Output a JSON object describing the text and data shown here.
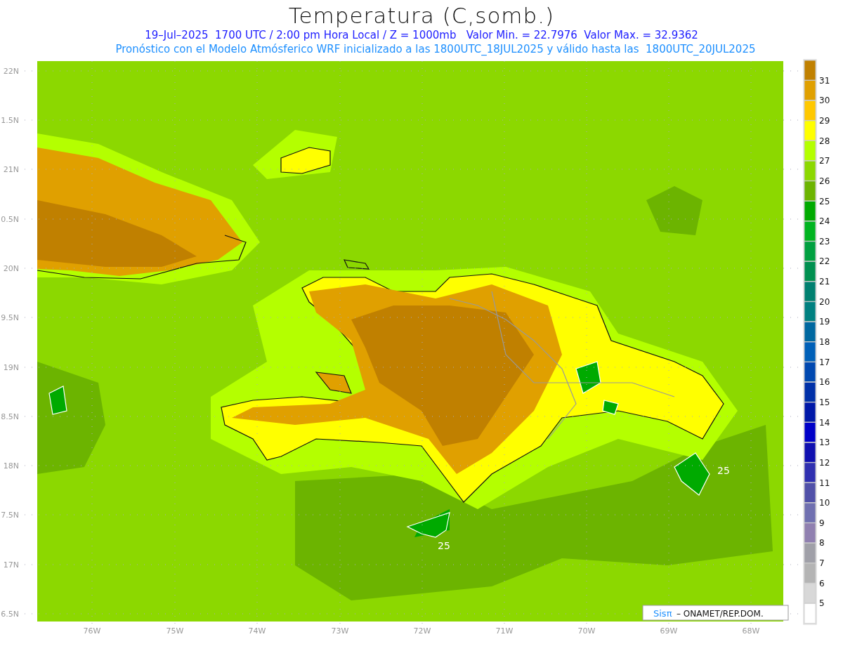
{
  "title": "Temperatura (C,somb.)",
  "subtitle": "19–Jul–2025  1700 UTC / 2:00 pm Hora Local / Z = 1000mb   Valor Min. = 22.7976  Valor Max. = 32.9362",
  "forecast_note": "Pronóstico con el Modelo Atmósferico WRF inicializado a las 1800UTC_18JUL2025 y válido hasta las  1800UTC_20JUL2025",
  "latitude_labels": [
    "22N",
    "1.5N",
    "21N",
    "0.5N",
    "20N",
    "9.5N",
    "19N",
    "8.5N",
    "18N",
    "7.5N",
    "17N",
    "6.5N"
  ],
  "longitude_labels": [
    "76W",
    "75W",
    "74W",
    "73W",
    "72W",
    "71W",
    "70W",
    "69W",
    "68W"
  ],
  "contour_labels": [
    "25",
    "25"
  ],
  "colorbar": [
    {
      "color": "#c08000",
      "label": "31"
    },
    {
      "color": "#e0a000",
      "label": "30"
    },
    {
      "color": "#ffc800",
      "label": "29"
    },
    {
      "color": "#ffff00",
      "label": "28"
    },
    {
      "color": "#b4ff00",
      "label": "27"
    },
    {
      "color": "#8cd800",
      "label": "26"
    },
    {
      "color": "#6cb400",
      "label": "25"
    },
    {
      "color": "#00aa00",
      "label": "24"
    },
    {
      "color": "#00b420",
      "label": "23"
    },
    {
      "color": "#00a040",
      "label": "22"
    },
    {
      "color": "#009050",
      "label": "21"
    },
    {
      "color": "#008070",
      "label": "20"
    },
    {
      "color": "#008080",
      "label": "19"
    },
    {
      "color": "#0068a0",
      "label": "18"
    },
    {
      "color": "#0060b8",
      "label": "17"
    },
    {
      "color": "#0048b0",
      "label": "16"
    },
    {
      "color": "#0030a8",
      "label": "15"
    },
    {
      "color": "#0018a8",
      "label": "14"
    },
    {
      "color": "#0000c8",
      "label": "13"
    },
    {
      "color": "#1010b0",
      "label": "12"
    },
    {
      "color": "#3030b0",
      "label": "11"
    },
    {
      "color": "#5050a8",
      "label": "10"
    },
    {
      "color": "#7070b0",
      "label": "9"
    },
    {
      "color": "#9080b0",
      "label": "8"
    },
    {
      "color": "#a0a0a8",
      "label": "7"
    },
    {
      "color": "#b4b4b4",
      "label": "6"
    },
    {
      "color": "#d8d8d8",
      "label": "5"
    },
    {
      "color": "#ffffff"
    }
  ],
  "credit": {
    "brand": "Sisπ",
    "text": "– ONAMET/REP.DOM."
  }
}
